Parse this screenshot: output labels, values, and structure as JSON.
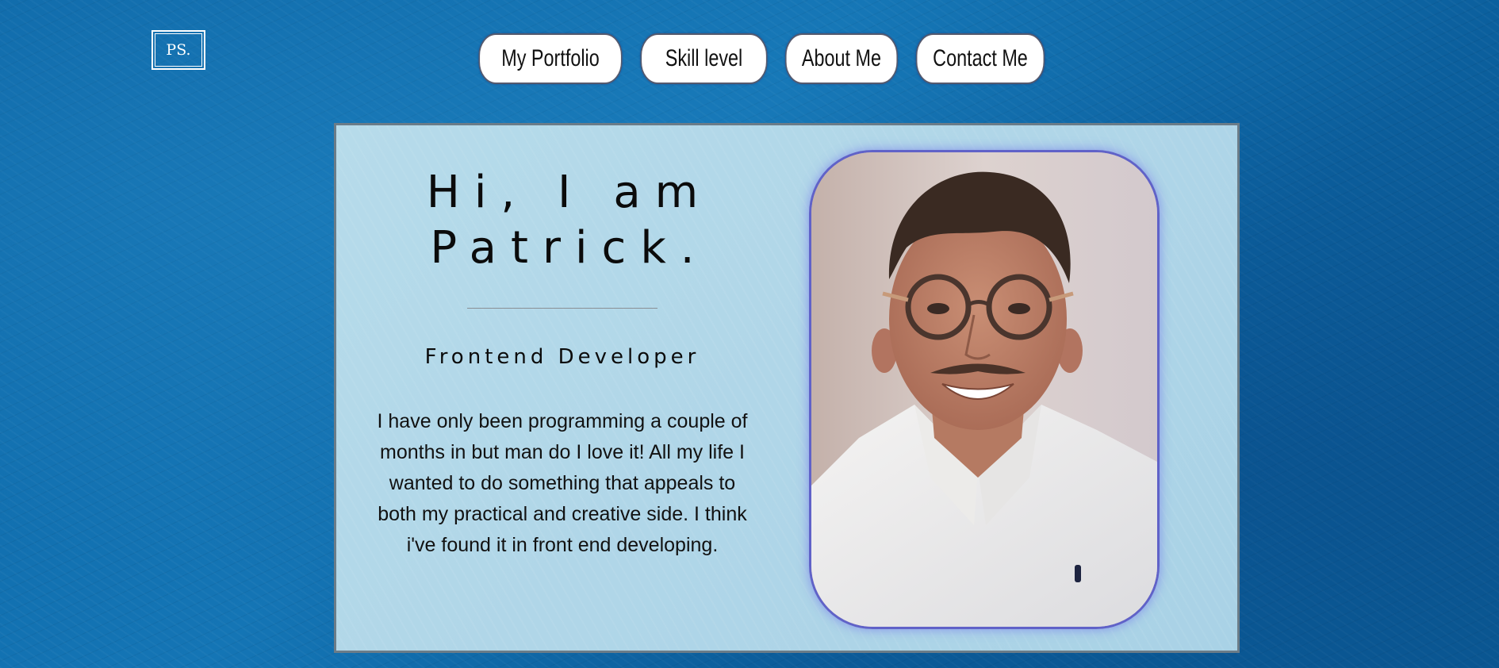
{
  "logo": {
    "text": "PS."
  },
  "nav": {
    "items": [
      {
        "label": "My Portfolio"
      },
      {
        "label": "Skill level"
      },
      {
        "label": "About Me"
      },
      {
        "label": "Contact Me"
      }
    ]
  },
  "hero": {
    "greeting_line1": "Hi, I am",
    "greeting_line2": "Patrick.",
    "role": "Frontend Developer",
    "bio": "I have only been programming a couple of months in but man do I love it! All my life I wanted to do something that appeals to both my practical and creative side. I think i've found it in front end developing.",
    "photo_alt": "portrait-photo"
  },
  "colors": {
    "background": "#0e68a8",
    "card": "#b3d8e9",
    "photo_border": "#6062c8",
    "nav_bg": "#ffffff",
    "text": "#0b0b0b"
  }
}
